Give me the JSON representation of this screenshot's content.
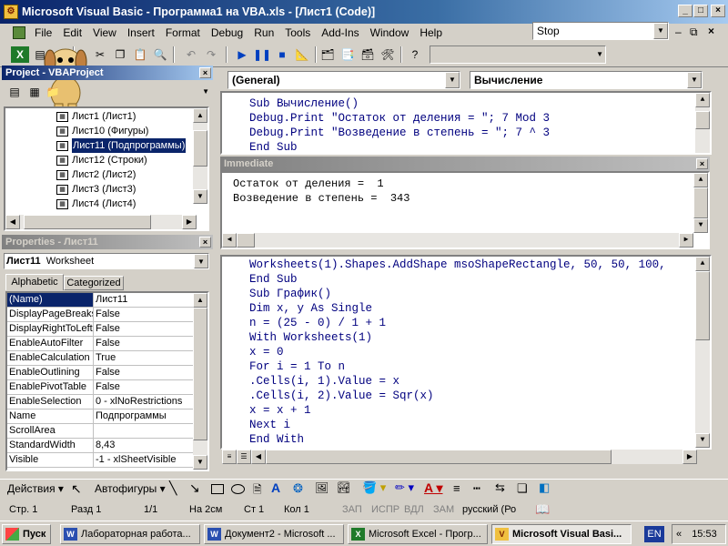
{
  "window": {
    "title": "Microsoft Visual Basic - Программа1 на VBA.xls - [Лист1 (Code)]"
  },
  "menu": {
    "items": [
      "File",
      "Edit",
      "View",
      "Insert",
      "Format",
      "Debug",
      "Run",
      "Tools",
      "Add-Ins",
      "Window",
      "Help"
    ],
    "search_value": "Stop"
  },
  "project": {
    "title": "Project - VBAProject",
    "items": [
      {
        "label": "Лист1 (Лист1)"
      },
      {
        "label": "Лист10 (Фигуры)"
      },
      {
        "label": "Лист11 (Подпрограммы)"
      },
      {
        "label": "Лист12 (Строки)"
      },
      {
        "label": "Лист2 (Лист2)"
      },
      {
        "label": "Лист3 (Лист3)"
      },
      {
        "label": "Лист4 (Лист4)"
      }
    ]
  },
  "properties": {
    "title": "Properties - Лист11",
    "object_name": "Лист11",
    "object_type": "Worksheet",
    "tabs": [
      "Alphabetic",
      "Categorized"
    ],
    "rows": [
      {
        "name": "(Name)",
        "value": "Лист11"
      },
      {
        "name": "DisplayPageBreaks",
        "value": "False"
      },
      {
        "name": "DisplayRightToLeft",
        "value": "False"
      },
      {
        "name": "EnableAutoFilter",
        "value": "False"
      },
      {
        "name": "EnableCalculation",
        "value": "True"
      },
      {
        "name": "EnableOutlining",
        "value": "False"
      },
      {
        "name": "EnablePivotTable",
        "value": "False"
      },
      {
        "name": "EnableSelection",
        "value": "0 - xlNoRestrictions"
      },
      {
        "name": "Name",
        "value": "Подпрограммы"
      },
      {
        "name": "ScrollArea",
        "value": ""
      },
      {
        "name": "StandardWidth",
        "value": "8,43"
      },
      {
        "name": "Visible",
        "value": "-1 - xlSheetVisible"
      }
    ]
  },
  "code_top": {
    "object": "(General)",
    "procedure": "Вычисление",
    "lines": [
      "Sub Вычисление()",
      "Debug.Print \"Остаток от деления = \"; 7 Mod 3",
      "Debug.Print \"Возведение в степень = \"; 7 ^ 3",
      "End Sub"
    ]
  },
  "immediate": {
    "title": "Immediate",
    "lines": [
      "Остаток от деления =  1",
      "Возведение в степень =  343"
    ]
  },
  "code_bottom": {
    "lines": [
      "Worksheets(1).Shapes.AddShape msoShapeRectangle, 50, 50, 100,",
      "End Sub",
      "Sub График()",
      "Dim x, y As Single",
      "n = (25 - 0) / 1 + 1",
      "With Worksheets(1)",
      "x = 0",
      "For i = 1 To n",
      ".Cells(i, 1).Value = x",
      ".Cells(i, 2).Value = Sqr(x)",
      "x = x + 1",
      "Next i",
      "End With"
    ]
  },
  "drawbar": {
    "actions_label": "Действия",
    "autoshapes_label": "Автофигуры"
  },
  "statusbar": {
    "page": "Стр. 1",
    "section": "Разд 1",
    "pages": "1/1",
    "at": "На 2см",
    "line": "Ст 1",
    "col": "Кол 1",
    "rec": "ЗАП",
    "trk": "ИСПР",
    "ext": "ВДЛ",
    "ovr": "ЗАМ",
    "lang": "русский (Ро"
  },
  "taskbar": {
    "start": "Пуск",
    "tasks": [
      {
        "label": "Лабораторная работа..."
      },
      {
        "label": "Документ2 - Microsoft ..."
      },
      {
        "label": "Microsoft Excel - Прогр..."
      },
      {
        "label": "Microsoft Visual Basi..."
      }
    ],
    "lang": "EN",
    "time": "15:53"
  },
  "colors": {
    "title_active": "#0a246a",
    "code_keyword": "#00007f"
  }
}
